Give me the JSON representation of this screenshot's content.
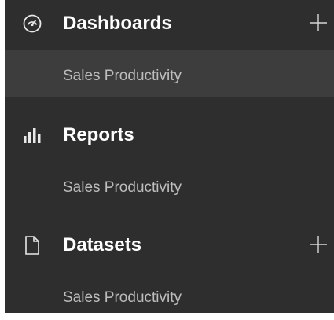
{
  "nav": {
    "sections": [
      {
        "label": "Dashboards",
        "icon": "gauge-icon",
        "has_add": true,
        "items": [
          {
            "label": "Sales Productivity",
            "selected": true
          }
        ]
      },
      {
        "label": "Reports",
        "icon": "bar-chart-icon",
        "has_add": false,
        "items": [
          {
            "label": "Sales Productivity",
            "selected": false
          }
        ]
      },
      {
        "label": "Datasets",
        "icon": "document-icon",
        "has_add": true,
        "items": [
          {
            "label": "Sales Productivity",
            "selected": false
          }
        ]
      }
    ],
    "colors": {
      "panel_background": "#2e2e2e",
      "selected_background": "#3d3d3d",
      "header_text": "#ffffff",
      "item_text": "#bdbdbd",
      "icon": "#e8e8e8"
    }
  }
}
